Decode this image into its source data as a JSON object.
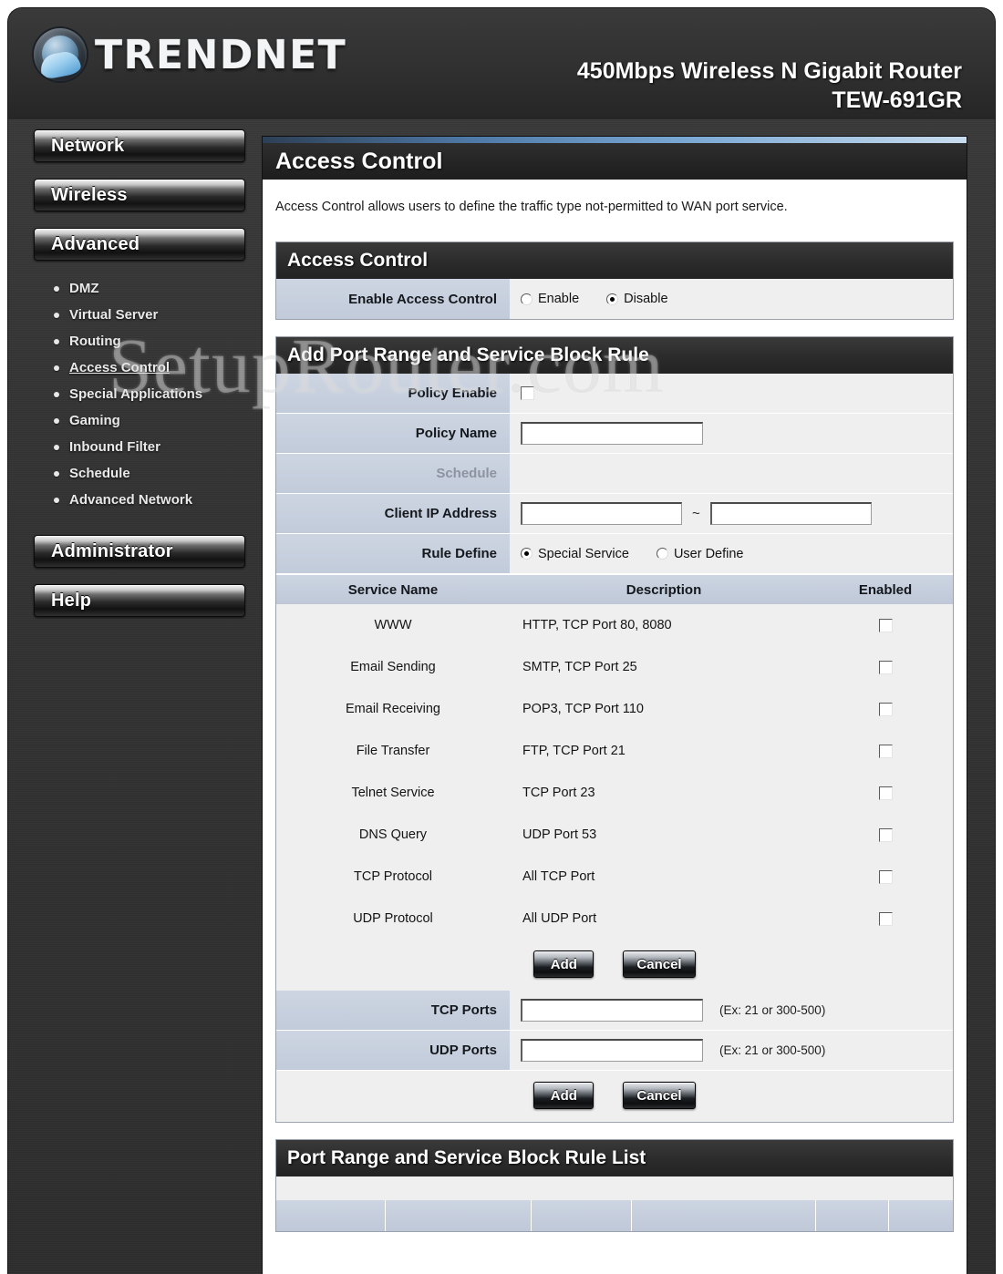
{
  "header": {
    "brand": "TRENDNET",
    "product_line": "450Mbps Wireless N Gigabit Router",
    "model": "TEW-691GR"
  },
  "watermark": "SetupRouter.com",
  "sidebar": {
    "buttons": [
      {
        "label": "Network"
      },
      {
        "label": "Wireless"
      },
      {
        "label": "Advanced"
      },
      {
        "label": "Administrator"
      },
      {
        "label": "Help"
      }
    ],
    "advanced_items": [
      {
        "label": "DMZ",
        "active": false
      },
      {
        "label": "Virtual Server",
        "active": false
      },
      {
        "label": "Routing",
        "active": false
      },
      {
        "label": "Access Control",
        "active": true
      },
      {
        "label": "Special Applications",
        "active": false
      },
      {
        "label": "Gaming",
        "active": false
      },
      {
        "label": "Inbound Filter",
        "active": false
      },
      {
        "label": "Schedule",
        "active": false
      },
      {
        "label": "Advanced Network",
        "active": false
      }
    ]
  },
  "page": {
    "title": "Access Control",
    "description": "Access Control allows users to define the traffic type not-permitted to WAN port service."
  },
  "access_control": {
    "section_title": "Access Control",
    "enable_label": "Enable Access Control",
    "option_enable": "Enable",
    "option_disable": "Disable",
    "selected": "Disable"
  },
  "add_rule": {
    "section_title": "Add Port Range and Service Block Rule",
    "policy_enable_label": "Policy Enable",
    "policy_enable_checked": false,
    "policy_name_label": "Policy Name",
    "policy_name_value": "",
    "schedule_label": "Schedule",
    "client_ip_label": "Client IP Address",
    "client_ip_start": "",
    "client_ip_end": "",
    "ip_separator": "~",
    "rule_define_label": "Rule Define",
    "rule_define_special": "Special Service",
    "rule_define_user": "User Define",
    "rule_define_selected": "Special Service",
    "service_table": {
      "columns": [
        "Service Name",
        "Description",
        "Enabled"
      ],
      "rows": [
        {
          "name": "WWW",
          "description": "HTTP, TCP Port 80, 8080",
          "enabled": false
        },
        {
          "name": "Email Sending",
          "description": "SMTP, TCP Port 25",
          "enabled": false
        },
        {
          "name": "Email Receiving",
          "description": "POP3, TCP Port 110",
          "enabled": false
        },
        {
          "name": "File Transfer",
          "description": "FTP, TCP Port 21",
          "enabled": false
        },
        {
          "name": "Telnet Service",
          "description": "TCP Port 23",
          "enabled": false
        },
        {
          "name": "DNS Query",
          "description": "UDP Port 53",
          "enabled": false
        },
        {
          "name": "TCP Protocol",
          "description": "All TCP Port",
          "enabled": false
        },
        {
          "name": "UDP Protocol",
          "description": "All UDP Port",
          "enabled": false
        }
      ]
    },
    "buttons_top": {
      "add": "Add",
      "cancel": "Cancel"
    },
    "tcp_ports_label": "TCP Ports",
    "tcp_ports_value": "",
    "tcp_ports_hint": "(Ex: 21 or 300-500)",
    "udp_ports_label": "UDP Ports",
    "udp_ports_value": "",
    "udp_ports_hint": "(Ex: 21 or 300-500)",
    "buttons_bottom": {
      "add": "Add",
      "cancel": "Cancel"
    }
  },
  "rule_list": {
    "section_title": "Port Range and Service Block Rule List"
  }
}
